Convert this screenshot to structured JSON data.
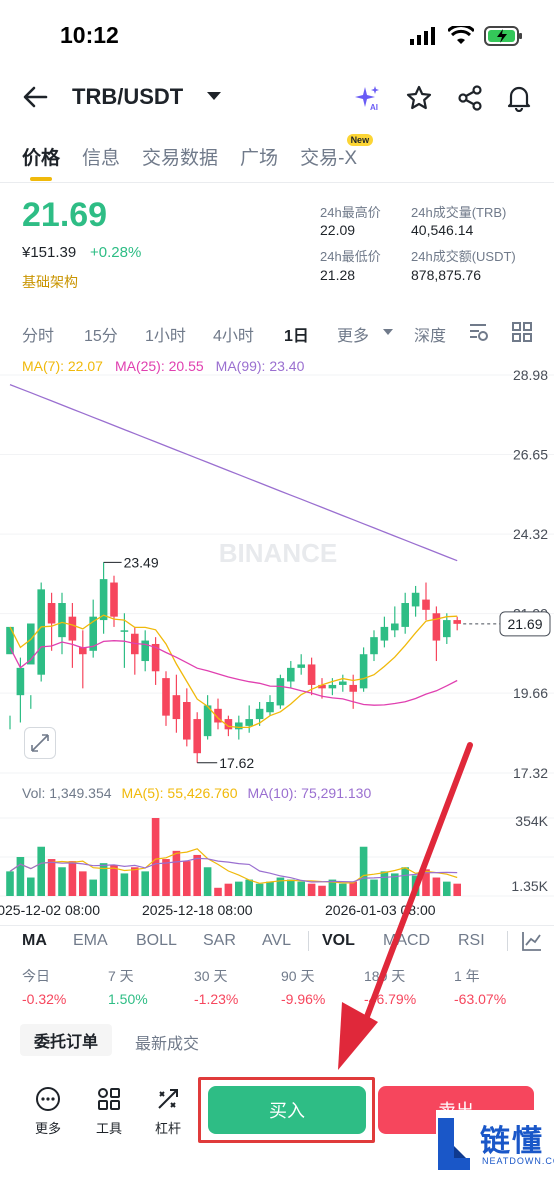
{
  "status": {
    "time": "10:12"
  },
  "header": {
    "pair": "TRB/USDT",
    "icons": [
      "back-arrow-icon",
      "ai-sparkle-icon",
      "star-icon",
      "share-icon",
      "bell-icon"
    ]
  },
  "tabs": [
    {
      "label": "价格",
      "active": true
    },
    {
      "label": "信息",
      "active": false
    },
    {
      "label": "交易数据",
      "active": false
    },
    {
      "label": "广场",
      "active": false
    },
    {
      "label": "交易-X",
      "active": false,
      "badge": "New"
    }
  ],
  "ticker": {
    "price": "21.69",
    "price_cny": "¥151.39",
    "change": "+0.28%",
    "tag": "基础架构",
    "stats": [
      {
        "label": "24h最高价",
        "value": "22.09"
      },
      {
        "label": "24h成交量(TRB)",
        "value": "40,546.14"
      },
      {
        "label": "24h最低价",
        "value": "21.28"
      },
      {
        "label": "24h成交额(USDT)",
        "value": "878,875.76"
      }
    ]
  },
  "timeframes": {
    "items": [
      "分时",
      "15分",
      "1小时",
      "4小时",
      "1日",
      "更多",
      "深度"
    ],
    "active": "1日"
  },
  "chart_data": {
    "type": "candlestick",
    "ma_legend": [
      {
        "label": "MA(7): 22.07",
        "color": "#f0b90b"
      },
      {
        "label": "MA(25): 20.55",
        "color": "#e040b0"
      },
      {
        "label": "MA(99): 23.40",
        "color": "#9a6fd0"
      }
    ],
    "price_axis": [
      "28.98",
      "26.65",
      "24.32",
      "21.99",
      "19.66",
      "17.32"
    ],
    "price_range": [
      17.32,
      28.98
    ],
    "last_price_label": "21.69",
    "high_marker": "23.49",
    "low_marker": "17.62",
    "watermark": "BINANCE",
    "candles": [
      [
        20.8,
        21.6,
        19.0,
        18.6
      ],
      [
        19.6,
        20.4,
        20.7,
        18.8
      ],
      [
        20.5,
        21.7,
        19.6,
        19.2
      ],
      [
        20.2,
        22.7,
        22.9,
        20.0
      ],
      [
        22.3,
        21.7,
        22.6,
        20.9
      ],
      [
        21.3,
        22.3,
        22.6,
        20.8
      ],
      [
        21.9,
        21.2,
        22.3,
        20.4
      ],
      [
        21.0,
        20.8,
        21.5,
        19.8
      ],
      [
        20.9,
        21.9,
        22.4,
        20.7
      ],
      [
        21.8,
        23.0,
        23.49,
        21.4
      ],
      [
        22.9,
        21.9,
        23.1,
        21.6
      ],
      [
        21.5,
        21.5,
        22.0,
        20.4
      ],
      [
        21.4,
        20.8,
        21.6,
        20.2
      ],
      [
        20.6,
        21.2,
        21.5,
        20.3
      ],
      [
        21.1,
        20.3,
        21.3,
        19.9
      ],
      [
        20.1,
        19.0,
        20.3,
        18.7
      ],
      [
        19.6,
        18.9,
        20.2,
        18.5
      ],
      [
        19.4,
        18.3,
        19.8,
        18.1
      ],
      [
        18.9,
        17.9,
        19.1,
        17.62
      ],
      [
        18.4,
        19.3,
        19.6,
        18.3
      ],
      [
        19.2,
        18.8,
        19.5,
        18.6
      ],
      [
        18.9,
        18.6,
        19.0,
        18.4
      ],
      [
        18.6,
        18.8,
        19.0,
        18.3
      ],
      [
        18.7,
        18.9,
        19.3,
        18.5
      ],
      [
        18.9,
        19.2,
        19.4,
        18.7
      ],
      [
        19.1,
        19.4,
        19.6,
        19.0
      ],
      [
        19.3,
        20.1,
        20.2,
        19.2
      ],
      [
        20.0,
        20.4,
        20.6,
        19.8
      ],
      [
        20.4,
        20.5,
        20.8,
        20.2
      ],
      [
        20.5,
        19.9,
        20.7,
        19.6
      ],
      [
        19.9,
        19.8,
        20.1,
        19.5
      ],
      [
        19.8,
        19.9,
        20.1,
        19.6
      ],
      [
        19.9,
        20.0,
        20.2,
        19.7
      ],
      [
        19.9,
        19.7,
        20.2,
        19.2
      ],
      [
        19.8,
        20.8,
        21.0,
        19.7
      ],
      [
        20.8,
        21.3,
        21.5,
        20.6
      ],
      [
        21.2,
        21.6,
        21.9,
        21.0
      ],
      [
        21.5,
        21.7,
        22.2,
        21.3
      ],
      [
        21.6,
        22.3,
        22.6,
        21.4
      ],
      [
        22.2,
        22.6,
        22.8,
        21.9
      ],
      [
        22.4,
        22.1,
        22.9,
        21.8
      ],
      [
        22.0,
        21.2,
        22.2,
        20.6
      ],
      [
        21.3,
        21.8,
        22.0,
        21.1
      ],
      [
        21.8,
        21.69,
        21.9,
        21.5
      ]
    ],
    "volume": {
      "legend": [
        {
          "label": "Vol: 1,349.354",
          "color": "#707a8a"
        },
        {
          "label": "MA(5): 55,426.760",
          "color": "#f0b90b"
        },
        {
          "label": "MA(10): 75,291.130",
          "color": "#9a6fd0"
        }
      ],
      "axis": [
        "354K",
        "1.35K"
      ],
      "max": 354
    },
    "x_labels": [
      "2025-12-02 08:00",
      "2025-12-18 08:00",
      "2026-01-03 08:00"
    ]
  },
  "indicators": {
    "items": [
      "MA",
      "EMA",
      "BOLL",
      "SAR",
      "AVL",
      "VOL",
      "MACD",
      "RSI"
    ],
    "active": [
      "MA",
      "VOL"
    ]
  },
  "performance": [
    {
      "label": "今日",
      "value": "-0.32%",
      "dir": "down"
    },
    {
      "label": "7 天",
      "value": "1.50%",
      "dir": "up"
    },
    {
      "label": "30 天",
      "value": "-1.23%",
      "dir": "down"
    },
    {
      "label": "90 天",
      "value": "-9.96%",
      "dir": "down"
    },
    {
      "label": "180 天",
      "value": "-46.79%",
      "dir": "down"
    },
    {
      "label": "1 年",
      "value": "-63.07%",
      "dir": "down"
    }
  ],
  "orders": {
    "tab_active": "委托订单",
    "tab_other": "最新成交"
  },
  "bottom": {
    "more": "更多",
    "tools": "工具",
    "leverage": "杠杆",
    "buy": "买入",
    "sell": "卖出"
  },
  "site_watermark": {
    "text": "链懂",
    "sub": "NEATDOWN.COM"
  }
}
